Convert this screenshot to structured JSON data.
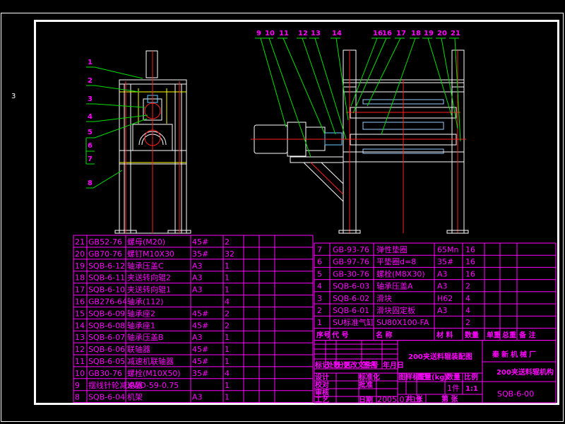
{
  "side_label": "3",
  "colors": {
    "background": "#000000",
    "table": "#ff00ff",
    "outline": "#ffffff",
    "centerline": "#ff2020",
    "leader": "#00e000",
    "hidden": "#ffff00"
  },
  "left_view_callouts": [
    "1",
    "2",
    "3",
    "4",
    "5",
    "6",
    "7",
    "8"
  ],
  "front_view_callouts": [
    "9",
    "10",
    "11",
    "12",
    "13",
    "14",
    "16",
    "16",
    "17",
    "18",
    "19",
    "20",
    "21"
  ],
  "parts_left": [
    [
      "21",
      "GB52-76",
      "螺母(M20)",
      "45#",
      "2"
    ],
    [
      "20",
      "GB70-76",
      "螺钉M10X30",
      "35#",
      "32"
    ],
    [
      "19",
      "SQB-6-12",
      "轴承压盖C",
      "A3",
      "1"
    ],
    [
      "18",
      "SQB-6-11",
      "夹送转向辊2",
      "A3",
      "1"
    ],
    [
      "17",
      "SQB-6-10",
      "夹送转向辊1",
      "A3",
      "1"
    ],
    [
      "16",
      "GB276-64",
      "轴承(112)",
      "",
      "4"
    ],
    [
      "15",
      "SQB-6-09",
      "轴承座2",
      "45#",
      "2"
    ],
    [
      "14",
      "SQB-6-08",
      "轴承座1",
      "45#",
      "2"
    ],
    [
      "13",
      "SQB-6-07",
      "轴承压盖B",
      "A3",
      "1"
    ],
    [
      "12",
      "SQB-6-06",
      "联轴器",
      "45#",
      "1"
    ],
    [
      "11",
      "SQB-6-05",
      "减速机联轴器",
      "45#",
      "1"
    ],
    [
      "10",
      "GB30-76",
      "螺栓(M10X50)",
      "35#",
      "4"
    ],
    [
      "9",
      "摆线针轮减速器",
      "XWD-59-0.75",
      "",
      "1"
    ],
    [
      "8",
      "SQB-6-04",
      "机架",
      "A3",
      "1"
    ]
  ],
  "parts_right": [
    [
      "7",
      "GB-93-76",
      "弹性垫圈",
      "65Mn",
      "16"
    ],
    [
      "6",
      "GB-97-76",
      "平垫圈d=8",
      "35#",
      "16"
    ],
    [
      "5",
      "GB-30-76",
      "螺栓(M8X30)",
      "A3",
      "16"
    ],
    [
      "4",
      "SQB-6-03",
      "轴承压盖A",
      "A3",
      "2"
    ],
    [
      "3",
      "SQB-6-02",
      "滑块",
      "H62",
      "4"
    ],
    [
      "2",
      "SQB-6-01",
      "滑块固定板",
      "A3",
      "4"
    ],
    [
      "1",
      "SU标准气缸",
      "SU80X100-FA",
      "",
      "2"
    ]
  ],
  "parts_header": [
    "序号",
    "代 号",
    "名 称",
    "材 料",
    "数量",
    "单重",
    "总重",
    "备 注"
  ],
  "title_block": {
    "drawing_title": "200夹送料辊装配图",
    "company": "秦新机械厂",
    "assembly_name": "200夹送料辊机构",
    "drawing_number": "SQB-6-00",
    "revision_headers": [
      "标记",
      "处数",
      "分区",
      "更改文件号",
      "签名",
      "年月日"
    ],
    "sign_labels": [
      "设计",
      "标准化",
      "校对",
      "批准",
      "审核",
      "工艺",
      "日期"
    ],
    "date": "2005.07.18",
    "stage_headers": [
      "图样标记",
      "重量(kg)",
      "数量",
      "比例"
    ],
    "quantity": "1件",
    "scale": "1:1",
    "sheets": [
      "共 张",
      "第 张"
    ]
  }
}
